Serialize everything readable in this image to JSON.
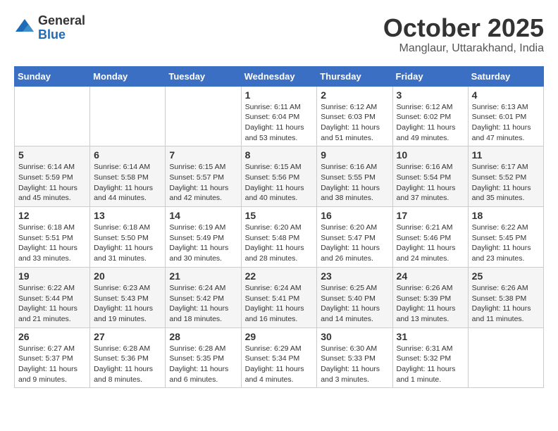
{
  "header": {
    "logo_general": "General",
    "logo_blue": "Blue",
    "month": "October 2025",
    "location": "Manglaur, Uttarakhand, India"
  },
  "weekdays": [
    "Sunday",
    "Monday",
    "Tuesday",
    "Wednesday",
    "Thursday",
    "Friday",
    "Saturday"
  ],
  "weeks": [
    [
      {
        "day": "",
        "info": ""
      },
      {
        "day": "",
        "info": ""
      },
      {
        "day": "",
        "info": ""
      },
      {
        "day": "1",
        "info": "Sunrise: 6:11 AM\nSunset: 6:04 PM\nDaylight: 11 hours\nand 53 minutes."
      },
      {
        "day": "2",
        "info": "Sunrise: 6:12 AM\nSunset: 6:03 PM\nDaylight: 11 hours\nand 51 minutes."
      },
      {
        "day": "3",
        "info": "Sunrise: 6:12 AM\nSunset: 6:02 PM\nDaylight: 11 hours\nand 49 minutes."
      },
      {
        "day": "4",
        "info": "Sunrise: 6:13 AM\nSunset: 6:01 PM\nDaylight: 11 hours\nand 47 minutes."
      }
    ],
    [
      {
        "day": "5",
        "info": "Sunrise: 6:14 AM\nSunset: 5:59 PM\nDaylight: 11 hours\nand 45 minutes."
      },
      {
        "day": "6",
        "info": "Sunrise: 6:14 AM\nSunset: 5:58 PM\nDaylight: 11 hours\nand 44 minutes."
      },
      {
        "day": "7",
        "info": "Sunrise: 6:15 AM\nSunset: 5:57 PM\nDaylight: 11 hours\nand 42 minutes."
      },
      {
        "day": "8",
        "info": "Sunrise: 6:15 AM\nSunset: 5:56 PM\nDaylight: 11 hours\nand 40 minutes."
      },
      {
        "day": "9",
        "info": "Sunrise: 6:16 AM\nSunset: 5:55 PM\nDaylight: 11 hours\nand 38 minutes."
      },
      {
        "day": "10",
        "info": "Sunrise: 6:16 AM\nSunset: 5:54 PM\nDaylight: 11 hours\nand 37 minutes."
      },
      {
        "day": "11",
        "info": "Sunrise: 6:17 AM\nSunset: 5:52 PM\nDaylight: 11 hours\nand 35 minutes."
      }
    ],
    [
      {
        "day": "12",
        "info": "Sunrise: 6:18 AM\nSunset: 5:51 PM\nDaylight: 11 hours\nand 33 minutes."
      },
      {
        "day": "13",
        "info": "Sunrise: 6:18 AM\nSunset: 5:50 PM\nDaylight: 11 hours\nand 31 minutes."
      },
      {
        "day": "14",
        "info": "Sunrise: 6:19 AM\nSunset: 5:49 PM\nDaylight: 11 hours\nand 30 minutes."
      },
      {
        "day": "15",
        "info": "Sunrise: 6:20 AM\nSunset: 5:48 PM\nDaylight: 11 hours\nand 28 minutes."
      },
      {
        "day": "16",
        "info": "Sunrise: 6:20 AM\nSunset: 5:47 PM\nDaylight: 11 hours\nand 26 minutes."
      },
      {
        "day": "17",
        "info": "Sunrise: 6:21 AM\nSunset: 5:46 PM\nDaylight: 11 hours\nand 24 minutes."
      },
      {
        "day": "18",
        "info": "Sunrise: 6:22 AM\nSunset: 5:45 PM\nDaylight: 11 hours\nand 23 minutes."
      }
    ],
    [
      {
        "day": "19",
        "info": "Sunrise: 6:22 AM\nSunset: 5:44 PM\nDaylight: 11 hours\nand 21 minutes."
      },
      {
        "day": "20",
        "info": "Sunrise: 6:23 AM\nSunset: 5:43 PM\nDaylight: 11 hours\nand 19 minutes."
      },
      {
        "day": "21",
        "info": "Sunrise: 6:24 AM\nSunset: 5:42 PM\nDaylight: 11 hours\nand 18 minutes."
      },
      {
        "day": "22",
        "info": "Sunrise: 6:24 AM\nSunset: 5:41 PM\nDaylight: 11 hours\nand 16 minutes."
      },
      {
        "day": "23",
        "info": "Sunrise: 6:25 AM\nSunset: 5:40 PM\nDaylight: 11 hours\nand 14 minutes."
      },
      {
        "day": "24",
        "info": "Sunrise: 6:26 AM\nSunset: 5:39 PM\nDaylight: 11 hours\nand 13 minutes."
      },
      {
        "day": "25",
        "info": "Sunrise: 6:26 AM\nSunset: 5:38 PM\nDaylight: 11 hours\nand 11 minutes."
      }
    ],
    [
      {
        "day": "26",
        "info": "Sunrise: 6:27 AM\nSunset: 5:37 PM\nDaylight: 11 hours\nand 9 minutes."
      },
      {
        "day": "27",
        "info": "Sunrise: 6:28 AM\nSunset: 5:36 PM\nDaylight: 11 hours\nand 8 minutes."
      },
      {
        "day": "28",
        "info": "Sunrise: 6:28 AM\nSunset: 5:35 PM\nDaylight: 11 hours\nand 6 minutes."
      },
      {
        "day": "29",
        "info": "Sunrise: 6:29 AM\nSunset: 5:34 PM\nDaylight: 11 hours\nand 4 minutes."
      },
      {
        "day": "30",
        "info": "Sunrise: 6:30 AM\nSunset: 5:33 PM\nDaylight: 11 hours\nand 3 minutes."
      },
      {
        "day": "31",
        "info": "Sunrise: 6:31 AM\nSunset: 5:32 PM\nDaylight: 11 hours\nand 1 minute."
      },
      {
        "day": "",
        "info": ""
      }
    ]
  ]
}
